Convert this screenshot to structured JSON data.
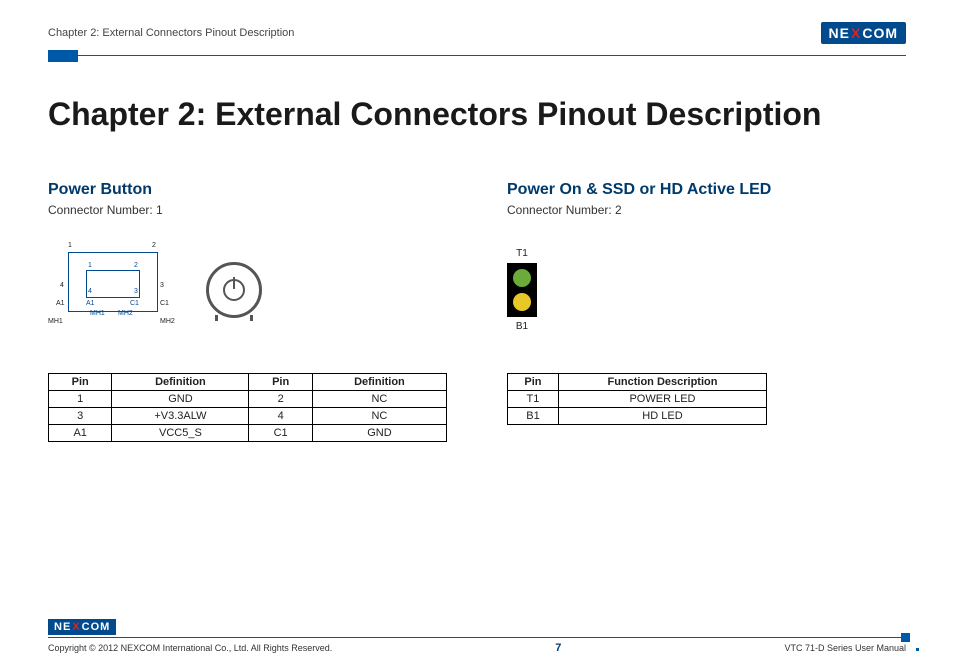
{
  "header": {
    "breadcrumb": "Chapter 2: External Connectors Pinout Description",
    "brand_left": "NE",
    "brand_x": "X",
    "brand_right": "COM"
  },
  "title": "Chapter 2: External Connectors Pinout Description",
  "left": {
    "heading": "Power Button",
    "connector": "Connector Number: 1",
    "diagram": {
      "top_left_outer": "1",
      "top_right_outer": "2",
      "bot_left_outer": "4",
      "bot_right_outer": "3",
      "a1_outer": "A1",
      "c1_outer": "C1",
      "mh1_outer": "MH1",
      "mh2_outer": "MH2",
      "inner_tl": "1",
      "inner_tr": "2",
      "inner_bl": "4",
      "inner_br": "3",
      "inner_a1": "A1",
      "inner_c1": "C1",
      "inner_mh1": "MH1",
      "inner_mh2": "MH2"
    },
    "table": {
      "h_pin": "Pin",
      "h_def": "Definition",
      "rows": [
        {
          "p1": "1",
          "d1": "GND",
          "p2": "2",
          "d2": "NC"
        },
        {
          "p1": "3",
          "d1": "+V3.3ALW",
          "p2": "4",
          "d2": "NC"
        },
        {
          "p1": "A1",
          "d1": "VCC5_S",
          "p2": "C1",
          "d2": "GND"
        }
      ]
    }
  },
  "right": {
    "heading": "Power On & SSD or HD Active LED",
    "connector": "Connector Number: 2",
    "diagram": {
      "t1": "T1",
      "b1": "B1"
    },
    "table": {
      "h_pin": "Pin",
      "h_func": "Function Description",
      "rows": [
        {
          "pin": "T1",
          "func": "POWER LED"
        },
        {
          "pin": "B1",
          "func": "HD LED"
        }
      ]
    }
  },
  "footer": {
    "copyright": "Copyright © 2012 NEXCOM International Co., Ltd. All Rights Reserved.",
    "page": "7",
    "manual": "VTC 71-D Series User Manual"
  }
}
